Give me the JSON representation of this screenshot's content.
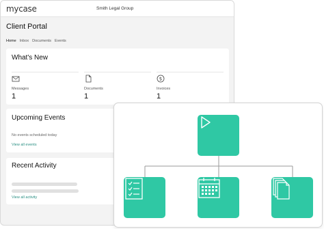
{
  "app": {
    "logo": "mycase",
    "firm_name": "Smith Legal Group"
  },
  "page_title": "Client Portal",
  "tabs": [
    {
      "label": "Home",
      "active": true
    },
    {
      "label": "Inbox"
    },
    {
      "label": "Documents"
    },
    {
      "label": "Events"
    }
  ],
  "whats_new": {
    "title": "What's New",
    "stats": [
      {
        "icon": "envelope-icon",
        "label": "Messages",
        "value": "1"
      },
      {
        "icon": "document-icon",
        "label": "Documents",
        "value": "1"
      },
      {
        "icon": "dollar-icon",
        "label": "Invoices",
        "value": "1"
      }
    ]
  },
  "upcoming_events": {
    "title": "Upcoming Events",
    "empty_text": "No events scheduled today",
    "link": "View all events"
  },
  "recent_activity": {
    "title": "Recent Activity",
    "link": "View all activity"
  },
  "diagram": {
    "top_icon": "play-icon",
    "children": [
      "checklist-icon",
      "calendar-icon",
      "documents-stack-icon"
    ]
  },
  "colors": {
    "accent": "#2fc8a4",
    "link": "#2a8f83"
  }
}
